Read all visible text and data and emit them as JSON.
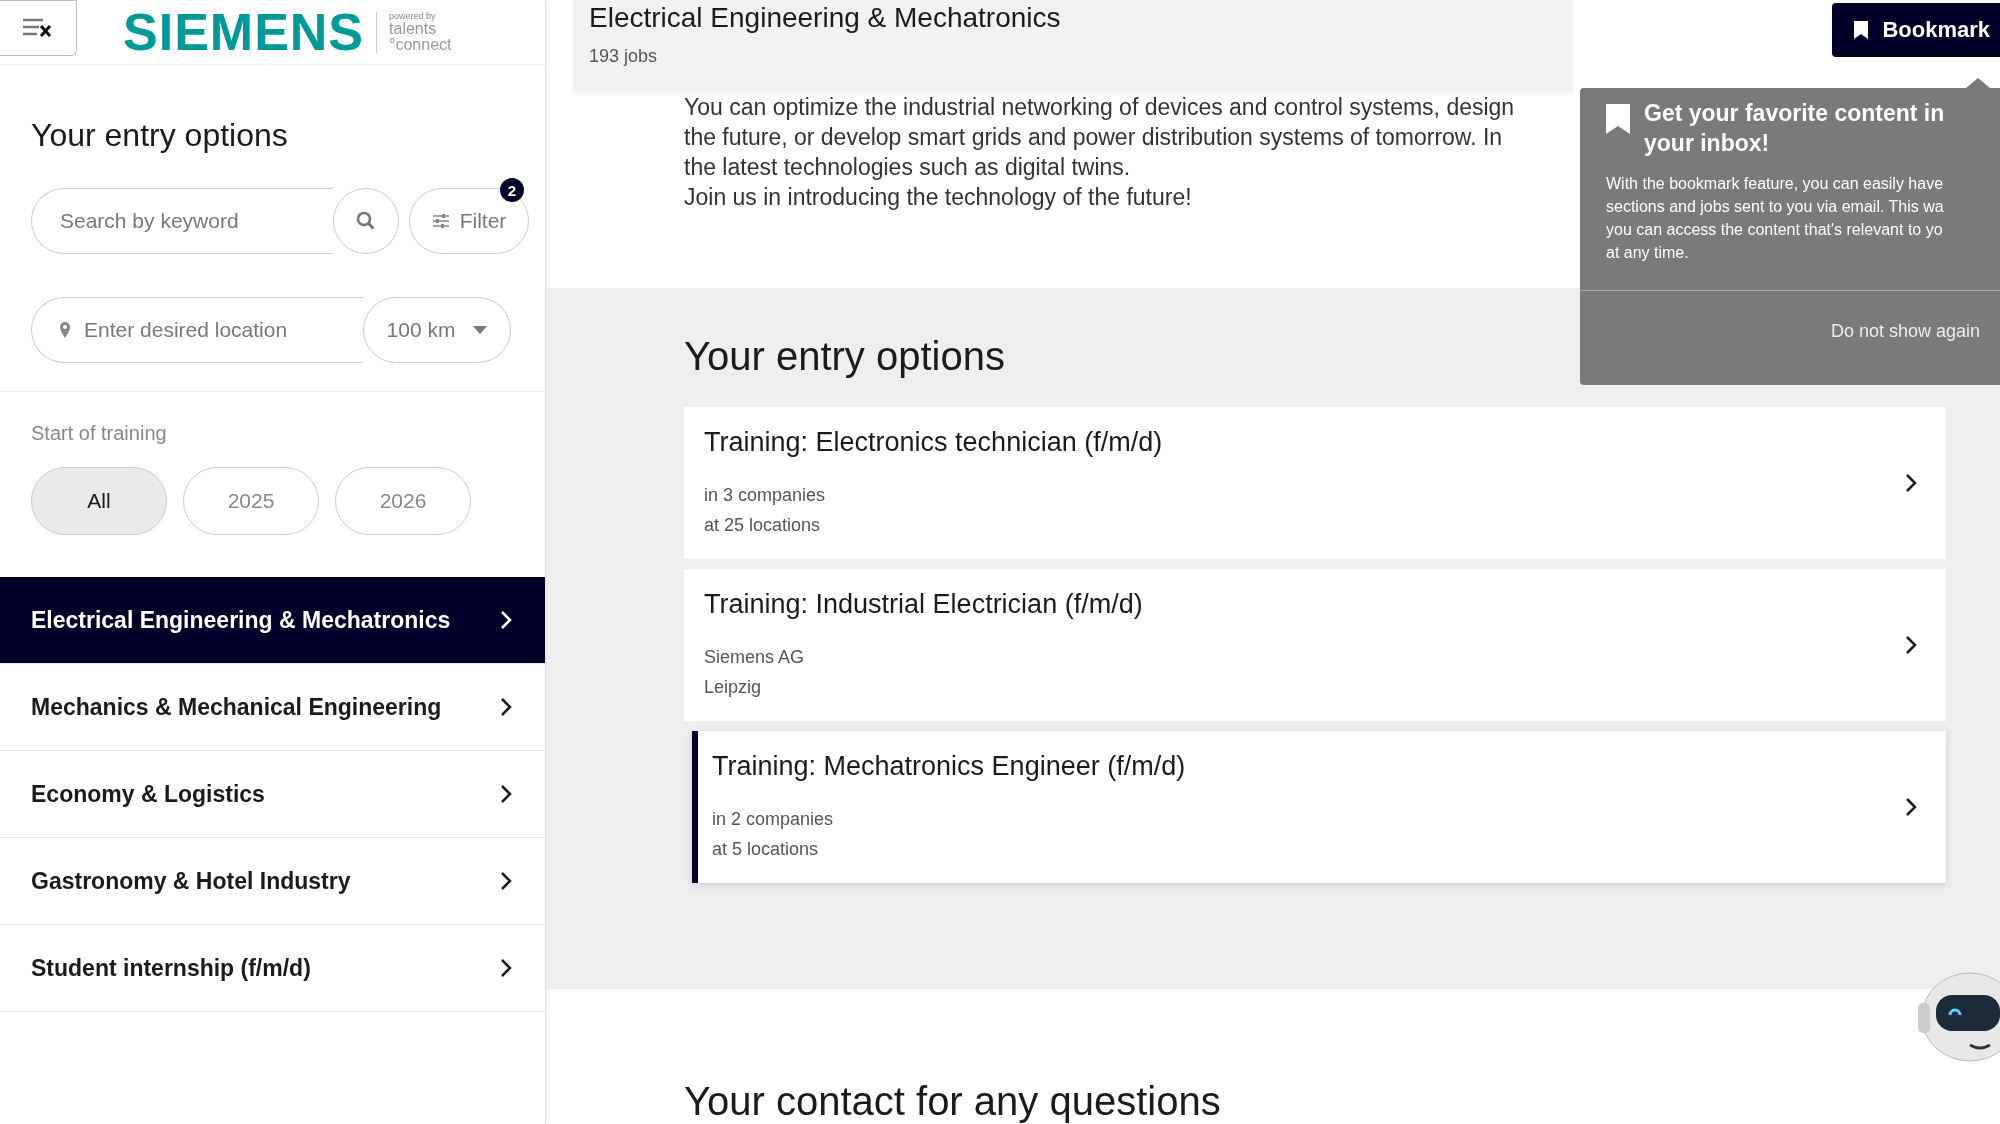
{
  "logo": {
    "brand": "SIEMENS",
    "powered_by": "powered by",
    "partner_line_1": "talents",
    "partner_line_2": "°connect"
  },
  "sidebar": {
    "heading": "Your entry options",
    "search": {
      "placeholder": "Search by keyword"
    },
    "filter": {
      "label": "Filter",
      "badge": "2"
    },
    "location": {
      "placeholder": "Enter desired location"
    },
    "radius": "100 km",
    "start_label": "Start of training",
    "chips": [
      {
        "label": "All",
        "selected": true
      },
      {
        "label": "2025",
        "selected": false
      },
      {
        "label": "2026",
        "selected": false
      }
    ],
    "categories": [
      {
        "label": "Electrical Engineering & Mechatronics",
        "selected": true
      },
      {
        "label": "Mechanics & Mechanical Engineering",
        "selected": false
      },
      {
        "label": "Economy & Logistics",
        "selected": false
      },
      {
        "label": "Gastronomy & Hotel Industry",
        "selected": false
      },
      {
        "label": "Student internship (f/m/d)",
        "selected": false
      }
    ]
  },
  "main": {
    "title": "Electrical Engineering & Mechatronics",
    "job_count": "193 jobs",
    "bookmark_button": "Bookmark",
    "intro_lines": [
      "You can optimize the industrial networking of devices and control systems, design",
      "the future, or develop smart grids and power distribution systems of tomorrow. In",
      "the latest technologies such as digital twins.",
      "Join us in introducing the technology of the future!"
    ],
    "section_heading": "Your entry options",
    "entries": [
      {
        "title": "Training: Electronics technician (f/m/d)",
        "line_1": "in 3 companies",
        "line_2": "at 25 locations",
        "selected": false
      },
      {
        "title": "Training: Industrial Electrician (f/m/d)",
        "line_1": "Siemens AG",
        "line_2": "Leipzig",
        "selected": false
      },
      {
        "title": "Training: Mechatronics Engineer (f/m/d)",
        "line_1": "in 2 companies",
        "line_2": "at 5 locations",
        "selected": true
      }
    ],
    "next_heading": "Your contact for any questions"
  },
  "popup": {
    "title": "Get your favorite content in your inbox!",
    "body_lines": [
      "With the bookmark feature, you can easily have",
      "sections and jobs sent to you via email. This wa",
      "you can access the content that's relevant to yo",
      "at any time."
    ],
    "dismiss": "Do not show again"
  }
}
